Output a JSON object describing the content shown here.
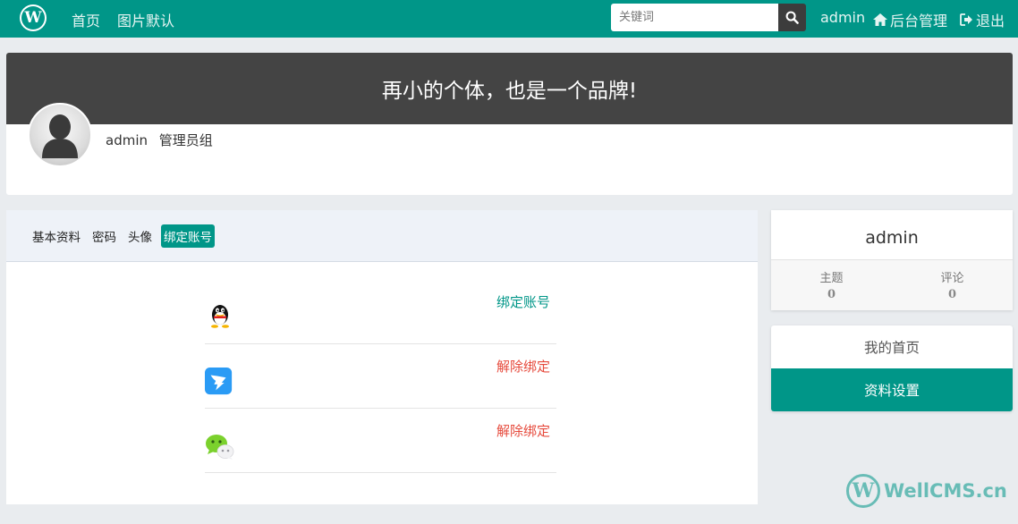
{
  "navbar": {
    "logo_letter": "W",
    "links": [
      "首页",
      "图片默认"
    ],
    "search_placeholder": "关键词",
    "user": "admin",
    "admin_label": "后台管理",
    "logout_label": "退出"
  },
  "banner": {
    "slogan": "再小的个体，也是一个品牌!",
    "username": "admin",
    "group": "管理员组"
  },
  "tabs": [
    {
      "label": "基本资料",
      "active": false
    },
    {
      "label": "密码",
      "active": false
    },
    {
      "label": "头像",
      "active": false
    },
    {
      "label": "绑定账号",
      "active": true
    }
  ],
  "bindings": [
    {
      "icon": "qq-icon",
      "action": "绑定账号",
      "color": "#009688"
    },
    {
      "icon": "dingtalk-icon",
      "action": "解除绑定",
      "color": "#e64a3c"
    },
    {
      "icon": "wechat-icon",
      "action": "解除绑定",
      "color": "#e64a3c"
    }
  ],
  "sidebar": {
    "username": "admin",
    "stats": [
      {
        "label": "主题",
        "value": "0"
      },
      {
        "label": "评论",
        "value": "0"
      }
    ],
    "menu": [
      {
        "label": "我的首页",
        "active": false
      },
      {
        "label": "资料设置",
        "active": true
      }
    ]
  },
  "watermark": {
    "letter": "W",
    "text": "WellCMS.cn"
  },
  "colors": {
    "primary": "#009688",
    "banner": "#444444",
    "danger": "#e64a3c"
  }
}
